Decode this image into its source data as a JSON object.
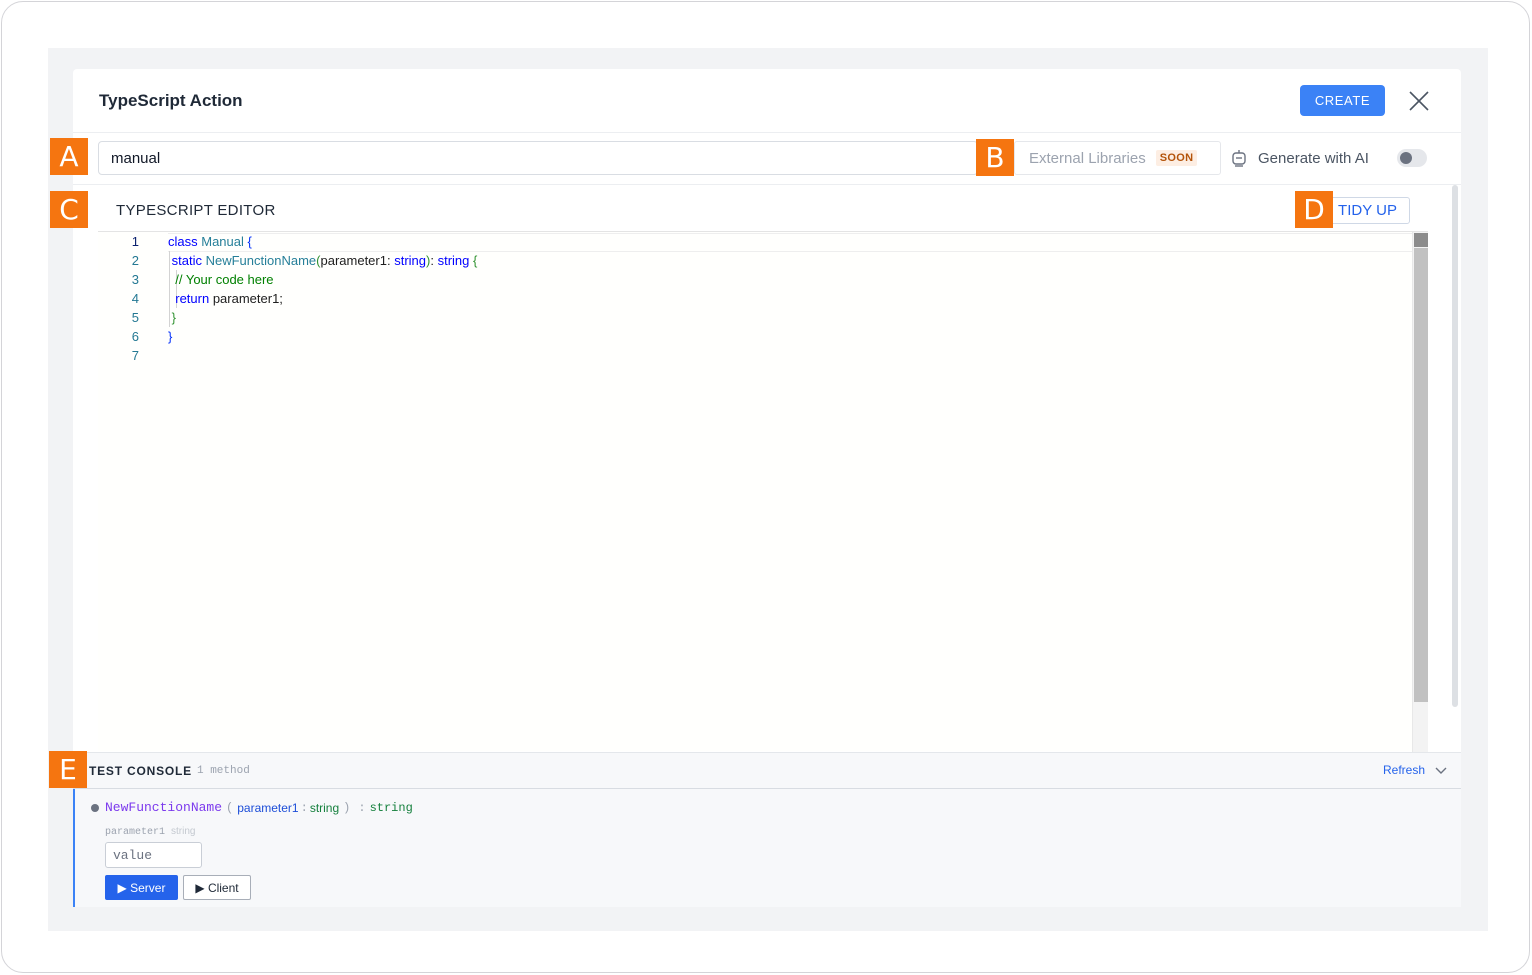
{
  "modal": {
    "title": "TypeScript Action",
    "create_label": "CREATE",
    "close_icon": "close-icon"
  },
  "toolbar": {
    "name_value": "manual",
    "external_libraries_label": "External Libraries",
    "soon_badge": "SOON",
    "generate_ai_label": "Generate with AI",
    "generate_ai_enabled": false
  },
  "editor": {
    "title": "TYPESCRIPT EDITOR",
    "tidy_label": "TIDY UP",
    "line_numbers": [
      "1",
      "2",
      "3",
      "4",
      "5",
      "6",
      "7"
    ],
    "active_line": 1,
    "code": {
      "l1_kw": "class",
      "l1_name": "Manual",
      "l1_brace": "{",
      "l2_kw": "static",
      "l2_fn": "NewFunctionName",
      "l2_open": "(",
      "l2_param": "parameter1:",
      "l2_type": "string",
      "l2_close": ")",
      "l2_colon": ":",
      "l2_ret": "string",
      "l2_brace": "{",
      "l3_comment": "// Your code here",
      "l4_kw": "return",
      "l4_rest": "parameter1;",
      "l5_brace": "}",
      "l6_brace": "}"
    }
  },
  "console": {
    "title": "TEST CONSOLE",
    "count": "1 method",
    "refresh_label": "Refresh",
    "method": {
      "name": "NewFunctionName",
      "open": "(",
      "param_name": "parameter1",
      "sep": ":",
      "param_type": "string",
      "close": ")",
      "ret_sep": ":",
      "ret_type": "string"
    },
    "param_label": "parameter1",
    "param_label_type": "string",
    "param_placeholder": "value",
    "server_label": "▶ Server",
    "client_label": "▶ Client"
  },
  "markers": [
    "A",
    "B",
    "C",
    "D",
    "E"
  ],
  "colors": {
    "primary": "#3b82f6",
    "marker": "#f57510"
  }
}
